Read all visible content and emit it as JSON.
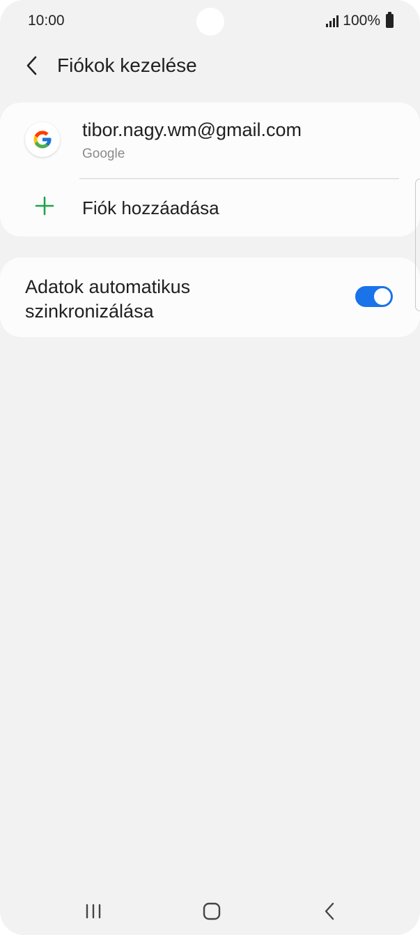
{
  "status_bar": {
    "time": "10:00",
    "battery": "100%"
  },
  "header": {
    "title": "Fiókok kezelése",
    "back_icon": "chevron-left-icon"
  },
  "accounts": [
    {
      "email": "tibor.nagy.wm@gmail.com",
      "type": "Google",
      "icon": "google-logo-icon"
    }
  ],
  "add_account": {
    "label": "Fiók hozzáadása",
    "icon": "plus-icon"
  },
  "sync": {
    "label_line1": "Adatok automatikus",
    "label_line2": "szinkronizálása",
    "enabled": true
  },
  "navigation": {
    "recents_icon": "recents-icon",
    "home_icon": "home-icon",
    "back_icon": "back-icon"
  },
  "colors": {
    "background": "#f2f2f2",
    "card": "#fcfcfc",
    "accent": "#1a73e8",
    "plus": "#1fa34a"
  }
}
